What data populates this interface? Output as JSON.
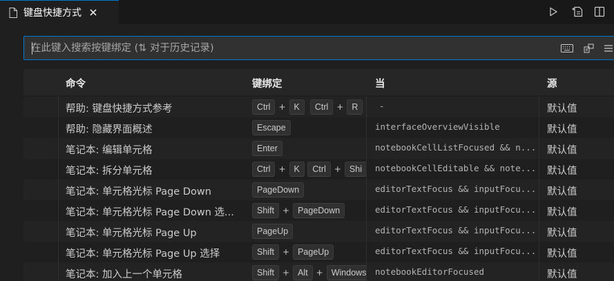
{
  "tab": {
    "title": "键盘快捷方式",
    "icon": "file-icon"
  },
  "actions": [
    "run-icon",
    "open-json-icon",
    "split-editor-icon"
  ],
  "search": {
    "placeholder": "在此键入搜索按键绑定 (⇅ 对于历史记录)",
    "value": ""
  },
  "search_actions": [
    "keyboard-icon",
    "sort-by-precedence-icon",
    "more-icon"
  ],
  "columns": {
    "command": "命令",
    "keybinding": "键绑定",
    "when": "当",
    "source": "源"
  },
  "rows": [
    {
      "command": "帮助: 键盘快捷方式参考",
      "keys": [
        [
          "Ctrl",
          "K"
        ],
        [
          "Ctrl",
          "R"
        ]
      ],
      "when": "-",
      "source": "默认值"
    },
    {
      "command": "帮助: 隐藏界面概述",
      "keys": [
        [
          "Escape"
        ]
      ],
      "when": "interfaceOverviewVisible",
      "source": "默认值"
    },
    {
      "command": "笔记本: 编辑单元格",
      "keys": [
        [
          "Enter"
        ]
      ],
      "when": "notebookCellListFocused && n...",
      "source": "默认值"
    },
    {
      "command": "笔记本: 拆分单元格",
      "keys": [
        [
          "Ctrl",
          "K"
        ],
        [
          "Ctrl",
          "Shi"
        ]
      ],
      "when": "notebookCellEditable && note...",
      "source": "默认值"
    },
    {
      "command": "笔记本: 单元格光标 Page Down",
      "keys": [
        [
          "PageDown"
        ]
      ],
      "when": "editorTextFocus && inputFocu...",
      "source": "默认值"
    },
    {
      "command": "笔记本: 单元格光标 Page Down 选...",
      "keys": [
        [
          "Shift",
          "PageDown"
        ]
      ],
      "when": "editorTextFocus && inputFocu...",
      "source": "默认值"
    },
    {
      "command": "笔记本: 单元格光标 Page Up",
      "keys": [
        [
          "PageUp"
        ]
      ],
      "when": "editorTextFocus && inputFocu...",
      "source": "默认值"
    },
    {
      "command": "笔记本: 单元格光标 Page Up 选择",
      "keys": [
        [
          "Shift",
          "PageUp"
        ]
      ],
      "when": "editorTextFocus && inputFocu...",
      "source": "默认值"
    },
    {
      "command": "笔记本: 加入上一个单元格",
      "keys": [
        [
          "Shift",
          "Alt",
          "Windows"
        ]
      ],
      "when": "notebookEditorFocused",
      "source": "默认值"
    }
  ],
  "colors": {
    "accent": "#0078d4",
    "background": "#1f1f1f",
    "tabbar": "#181818",
    "header": "#262626",
    "row_alt": "#232323"
  }
}
